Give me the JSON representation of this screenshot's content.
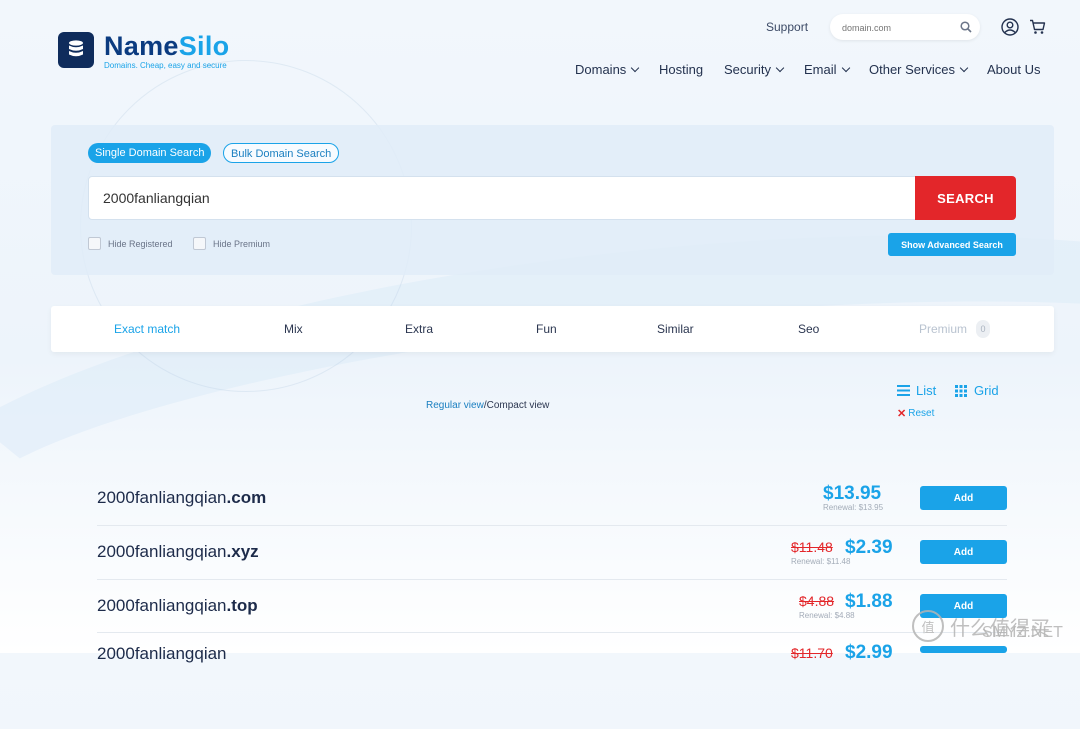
{
  "brand": {
    "name_part1": "Name",
    "name_part2": "Silo",
    "tagline": "Domains. Cheap, easy and secure"
  },
  "header": {
    "support_label": "Support",
    "search_placeholder": "domain.com",
    "nav": [
      {
        "label": "Domains",
        "dropdown": true
      },
      {
        "label": "Hosting",
        "dropdown": false
      },
      {
        "label": "Security",
        "dropdown": true
      },
      {
        "label": "Email",
        "dropdown": true
      },
      {
        "label": "Other Services",
        "dropdown": true
      },
      {
        "label": "About Us",
        "dropdown": false
      }
    ]
  },
  "search": {
    "mode_single": "Single Domain Search",
    "mode_bulk": "Bulk Domain Search",
    "query": "2000fanliangqian",
    "button_label": "SEARCH",
    "hide_registered": "Hide Registered",
    "hide_premium": "Hide Premium",
    "advanced_label": "Show Advanced Search"
  },
  "tabs": [
    {
      "label": "Exact match",
      "state": "active"
    },
    {
      "label": "Mix",
      "state": "normal"
    },
    {
      "label": "Extra",
      "state": "normal"
    },
    {
      "label": "Fun",
      "state": "normal"
    },
    {
      "label": "Similar",
      "state": "normal"
    },
    {
      "label": "Seo",
      "state": "normal"
    },
    {
      "label": "Premium",
      "state": "disabled",
      "badge": "0"
    }
  ],
  "view": {
    "regular": "Regular view",
    "separator": "/",
    "compact": "Compact view",
    "list_label": "List",
    "grid_label": "Grid",
    "reset_label": "Reset"
  },
  "results": [
    {
      "base": "2000fanliangqian",
      "tld": ".com",
      "old_price": "",
      "price": "$13.95",
      "renewal": "Renewal: $13.95",
      "action": "Add"
    },
    {
      "base": "2000fanliangqian",
      "tld": ".xyz",
      "old_price": "$11.48",
      "price": "$2.39",
      "renewal": "Renewal: $11.48",
      "action": "Add"
    },
    {
      "base": "2000fanliangqian",
      "tld": ".top",
      "old_price": "$4.88",
      "price": "$1.88",
      "renewal": "Renewal: $4.88",
      "action": "Add"
    },
    {
      "base": "2000fanliangqian",
      "tld": "",
      "old_price": "$11.70",
      "price": "$2.99",
      "renewal": "",
      "action": ""
    }
  ],
  "watermark": {
    "glyph": "值",
    "text": "什么值得买",
    "sub": "SMYZ.NET"
  },
  "colors": {
    "accent": "#1aa3e8",
    "search_button": "#e3262a",
    "brand_dark": "#0b3b80",
    "text": "#1d2b4a"
  }
}
